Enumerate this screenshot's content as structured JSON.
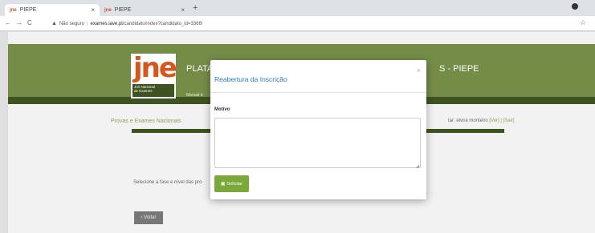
{
  "browser": {
    "tabs": [
      {
        "favicon": "jne",
        "title": "PIEPE",
        "close": "×"
      },
      {
        "favicon": "jne",
        "title": "PIEPE",
        "close": "×"
      }
    ],
    "new_tab": "+",
    "nav": {
      "back": "←",
      "forward": "→",
      "reload": "C"
    },
    "url": {
      "security": "Não seguro",
      "host": "exames.iave.pt",
      "path": "/candidato/index?candidato_id=3366!"
    },
    "star": "☆"
  },
  "page": {
    "platform_left": "PLATA",
    "platform_right": "S - PIEPE",
    "manual": "Manual d",
    "logo": {
      "letters": "jne",
      "subtitle_line1": "Júri Nacional",
      "subtitle_line2": "de Exames"
    },
    "provas": "Provas e Exames Nacionais",
    "user_prefix": "tar: elvira monteiro",
    "user_links": "[Ver] | [Sair]",
    "selecione": "Selecione a fase e nível das pro",
    "voltar": "Voltar",
    "voltar_icon": "‹"
  },
  "modal": {
    "title": "Reabertura da Inscrição",
    "close": "×",
    "motivo_label": "Motivo",
    "motivo_value": "",
    "submit_label": "Solicitar",
    "submit_icon": "save-icon"
  },
  "colors": {
    "header_green": "#758c47",
    "dark_green": "#3e5320",
    "button_green": "#7aa83a",
    "title_blue": "#2e7ab8",
    "logo_orange": "#d9551e"
  }
}
